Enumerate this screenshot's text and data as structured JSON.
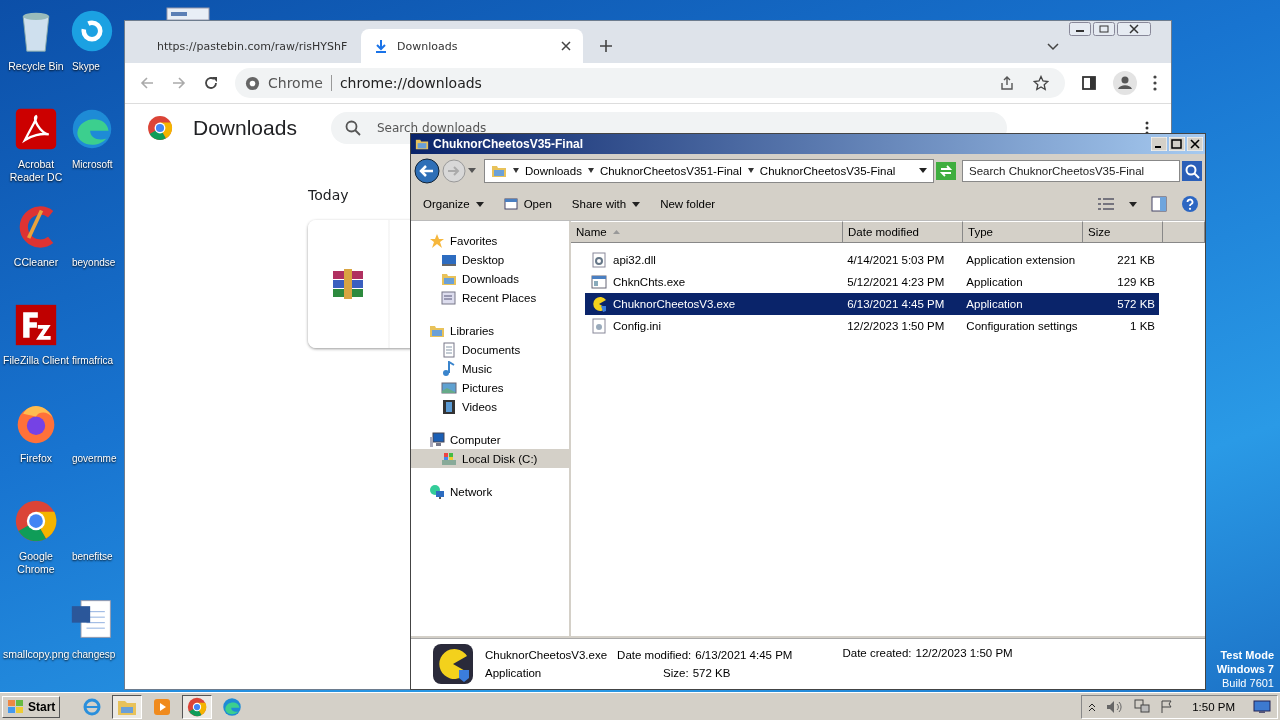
{
  "desktop_icons": [
    {
      "label": "Recycle Bin",
      "kind": "recycle"
    },
    {
      "label": "Skype",
      "kind": "skype"
    },
    {
      "label": "Acrobat Reader DC",
      "kind": "acrobat"
    },
    {
      "label": "Microsoft",
      "kind": "edge"
    },
    {
      "label": "CCleaner",
      "kind": "ccleaner"
    },
    {
      "label": "beyondse",
      "kind": "none"
    },
    {
      "label": "FileZilla Client",
      "kind": "filezilla"
    },
    {
      "label": "firmafrica",
      "kind": "none"
    },
    {
      "label": "Firefox",
      "kind": "firefox"
    },
    {
      "label": "governme",
      "kind": "none"
    },
    {
      "label": "Google Chrome",
      "kind": "chrome"
    },
    {
      "label": "benefitse",
      "kind": "none"
    },
    {
      "label": "smallcopy.png",
      "kind": "none"
    },
    {
      "label": "changesp",
      "kind": "word"
    }
  ],
  "chrome": {
    "tabs": [
      {
        "title": "https://pastebin.com/raw/risHYShF",
        "kind": "binary",
        "selected": false
      },
      {
        "title": "Downloads",
        "kind": "download",
        "selected": true
      }
    ],
    "omnibox": {
      "chip": "Chrome",
      "url": "chrome://downloads"
    },
    "page": {
      "title": "Downloads",
      "search_placeholder": "Search downloads",
      "section": "Today"
    }
  },
  "explorer": {
    "title": "ChuknorCheetosV35-Final",
    "breadcrumb": [
      "Downloads",
      "ChuknorCheetosV351-Final",
      "ChuknorCheetosV35-Final"
    ],
    "search_placeholder": "Search ChuknorCheetosV35-Final",
    "toolbar": [
      {
        "label": "Organize",
        "kind": "menu"
      },
      {
        "label": "Open",
        "kind": "open"
      },
      {
        "label": "Share with",
        "kind": "menu"
      },
      {
        "label": "New folder",
        "kind": "plain"
      }
    ],
    "nav": [
      {
        "label": "Favorites",
        "kind": "star",
        "selected": false,
        "children": [
          {
            "label": "Desktop",
            "kind": "desktop",
            "selected": false
          },
          {
            "label": "Downloads",
            "kind": "folder",
            "selected": false
          },
          {
            "label": "Recent Places",
            "kind": "recent",
            "selected": false
          }
        ]
      },
      {
        "label": "Libraries",
        "kind": "folder",
        "selected": false,
        "children": [
          {
            "label": "Documents",
            "kind": "doc",
            "selected": false
          },
          {
            "label": "Music",
            "kind": "music",
            "selected": false
          },
          {
            "label": "Pictures",
            "kind": "pictures",
            "selected": false
          },
          {
            "label": "Videos",
            "kind": "videos",
            "selected": false
          }
        ]
      },
      {
        "label": "Computer",
        "kind": "computer",
        "selected": false,
        "children": [
          {
            "label": "Local Disk (C:)",
            "kind": "disk",
            "selected": true
          }
        ]
      },
      {
        "label": "Network",
        "kind": "network",
        "selected": false
      }
    ],
    "columns": [
      "Name",
      "Date modified",
      "Type",
      "Size"
    ],
    "files": [
      {
        "name": "api32.dll",
        "date": "4/14/2021 5:03 PM",
        "type": "Application extension",
        "size": "221 KB",
        "kind": "dll",
        "selected": false
      },
      {
        "name": "ChknChts.exe",
        "date": "5/12/2021 4:23 PM",
        "type": "Application",
        "size": "129 KB",
        "kind": "exe",
        "selected": false
      },
      {
        "name": "ChuknorCheetosV3.exe",
        "date": "6/13/2021 4:45 PM",
        "type": "Application",
        "size": "572 KB",
        "kind": "pac",
        "selected": true
      },
      {
        "name": "Config.ini",
        "date": "12/2/2023 1:50 PM",
        "type": "Configuration settings",
        "size": "1 KB",
        "kind": "ini",
        "selected": false
      }
    ],
    "details": {
      "name": "ChuknorCheetosV3.exe",
      "type": "Application",
      "modified_label": "Date modified:",
      "modified": "6/13/2021 4:45 PM",
      "size_label": "Size:",
      "size": "572 KB",
      "created_label": "Date created:",
      "created": "12/2/2023 1:50 PM"
    }
  },
  "os_notice": [
    "Test Mode",
    "Windows 7",
    "Build 7601"
  ],
  "taskbar": {
    "start": "Start",
    "apps": [
      {
        "kind": "ie",
        "selected": false
      },
      {
        "kind": "explorer",
        "selected": true
      },
      {
        "kind": "media",
        "selected": false
      },
      {
        "kind": "chrome",
        "selected": true
      },
      {
        "kind": "edge",
        "selected": false
      }
    ],
    "clock": "1:50 PM"
  }
}
